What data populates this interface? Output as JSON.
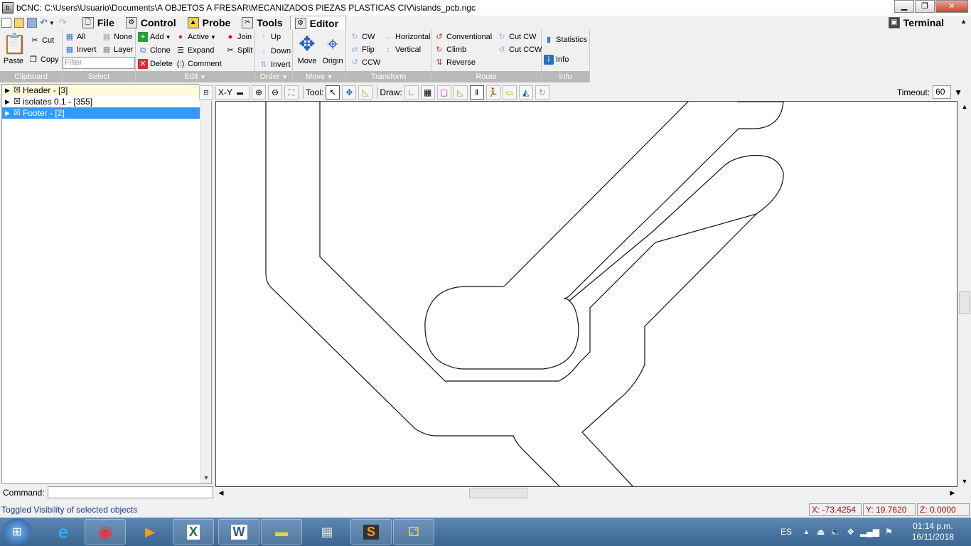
{
  "window": {
    "title": "bCNC: C:\\Users\\Usuario\\Documents\\A OBJETOS A FRESAR\\MECANIZADOS PIEZAS PLASTICAS CIV\\islands_pcb.ngc",
    "minimize": "▁",
    "maximize": "❐",
    "close": "✕"
  },
  "tabs": [
    {
      "label": "File",
      "icon": "file-icon",
      "glyph": "🗋"
    },
    {
      "label": "Control",
      "icon": "control-icon",
      "glyph": "⚙"
    },
    {
      "label": "Probe",
      "icon": "probe-icon",
      "glyph": "📐"
    },
    {
      "label": "Tools",
      "icon": "tools-icon",
      "glyph": "✂"
    },
    {
      "label": "Editor",
      "icon": "editor-icon",
      "glyph": "⚙",
      "active": true
    }
  ],
  "terminal_tab": {
    "label": "Terminal",
    "glyph": "▣"
  },
  "ribbon": {
    "clipboard": {
      "label": "Clipboard",
      "paste": "Paste",
      "cut": "Cut",
      "copy": "Copy"
    },
    "select": {
      "label": "Select",
      "all": "All",
      "none": "None",
      "invert": "Invert",
      "layer": "Layer",
      "filter_placeholder": "Filter"
    },
    "edit": {
      "label": "Edit",
      "add": "Add",
      "active": "Active",
      "join": "Join",
      "clone": "Clone",
      "expand": "Expand",
      "split": "Split",
      "delete": "Delete",
      "comment": "Comment"
    },
    "order": {
      "label": "Order",
      "up": "Up",
      "down": "Down",
      "invert": "Invert"
    },
    "move": {
      "label": "Move",
      "move": "Move",
      "origin": "Origin"
    },
    "transform": {
      "label": "Transform",
      "cw": "CW",
      "horizontal": "Horizontal",
      "flip": "Flip",
      "vertical": "Vertical",
      "ccw": "CCW"
    },
    "route": {
      "label": "Route",
      "conventional": "Conventional",
      "cut_cw": "Cut CW",
      "climb": "Climb",
      "cut_ccw": "Cut CCW",
      "reverse": "Reverse"
    },
    "info": {
      "label": "Info",
      "statistics": "Statistics",
      "info": "Info"
    }
  },
  "tree": [
    {
      "label": "Header - [3]",
      "style": "hdr"
    },
    {
      "label": "isolates 0.1 - [355]",
      "style": "normal"
    },
    {
      "label": "Footer - [2]",
      "style": "sel"
    }
  ],
  "canvas_toolbar": {
    "view": "X-Y",
    "tool_label": "Tool:",
    "draw_label": "Draw:",
    "timeout_label": "Timeout:",
    "timeout_value": "60"
  },
  "command": {
    "label": "Command:"
  },
  "status": {
    "message": "Toggled Visibility of selected objects",
    "x": "X: -73.4254",
    "y": "Y: 19.7620",
    "z": "Z: 0.0000"
  },
  "taskbar": {
    "lang": "ES",
    "time": "01:14 p.m.",
    "date": "16/11/2018"
  }
}
